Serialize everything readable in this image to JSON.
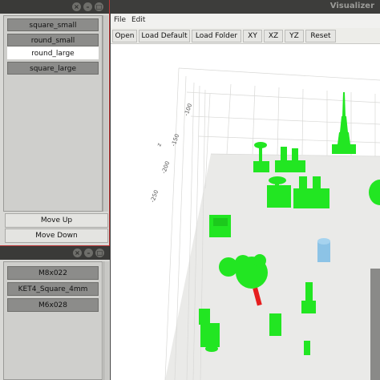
{
  "shapes": [
    "square_small",
    "round_small",
    "round_large",
    "square_large"
  ],
  "selected_shape": "round_large",
  "buttons": {
    "move_up": "Move Up",
    "move_down": "Move Down"
  },
  "parts": [
    "M8x022",
    "KET4_Square_4mm",
    "M6x028"
  ],
  "visualizer": {
    "title": "Visualizer",
    "menu": [
      "File",
      "Edit"
    ],
    "toolbar": [
      "Open",
      "Load Default",
      "Load Folder",
      "XY",
      "XZ",
      "YZ",
      "Reset"
    ],
    "axis_ticks": [
      "-100",
      "-150",
      "-200",
      "-250"
    ],
    "axis_name": "z"
  },
  "colors": {
    "part_green": "#22e622",
    "highlight_red": "#e61e1e",
    "cylinder_blue": "#8cc3e6",
    "titlebar": "#3a3a38"
  }
}
